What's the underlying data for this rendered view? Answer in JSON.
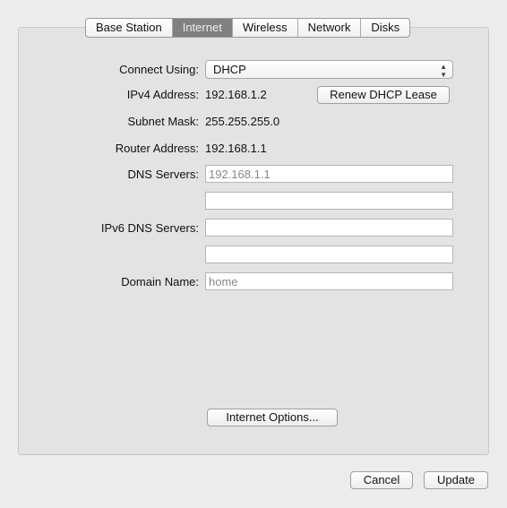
{
  "tabs": [
    {
      "label": "Base Station"
    },
    {
      "label": "Internet",
      "selected": true
    },
    {
      "label": "Wireless"
    },
    {
      "label": "Network"
    },
    {
      "label": "Disks"
    }
  ],
  "form": {
    "connect_using": {
      "label": "Connect Using:",
      "value": "DHCP"
    },
    "ipv4": {
      "label": "IPv4 Address:",
      "value": "192.168.1.2"
    },
    "renew_button": "Renew DHCP Lease",
    "subnet": {
      "label": "Subnet Mask:",
      "value": "255.255.255.0"
    },
    "router": {
      "label": "Router Address:",
      "value": "192.168.1.1"
    },
    "dns": {
      "label": "DNS Servers:",
      "placeholder1": "192.168.1.1",
      "value2": ""
    },
    "ipv6dns": {
      "label": "IPv6 DNS Servers:",
      "value1": "",
      "value2": ""
    },
    "domain": {
      "label": "Domain Name:",
      "placeholder": "home"
    },
    "internet_options_button": "Internet Options..."
  },
  "footer": {
    "cancel": "Cancel",
    "update": "Update"
  },
  "icons": {
    "select_arrows": "up-down-chevron-icon"
  }
}
